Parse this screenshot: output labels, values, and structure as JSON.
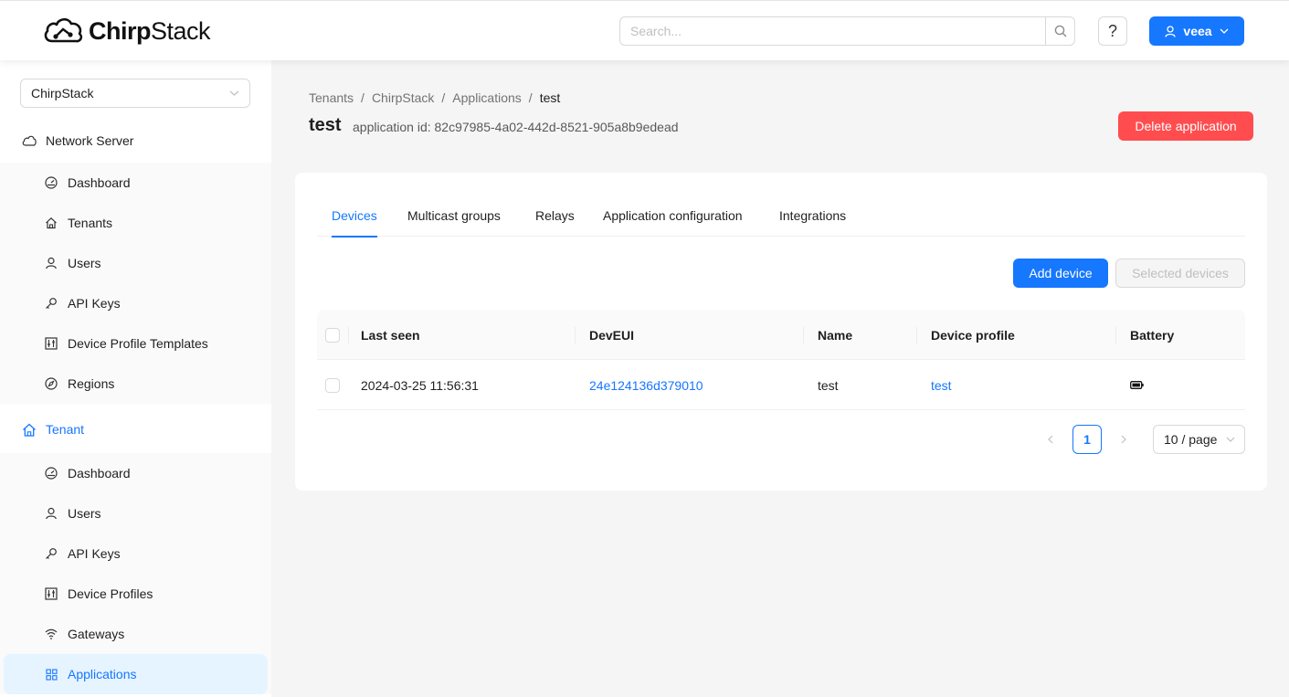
{
  "header": {
    "logo_text_bold": "Chirp",
    "logo_text_rest": "Stack",
    "search_placeholder": "Search...",
    "help_label": "?",
    "user_name": "veea"
  },
  "sidebar": {
    "tenant_select": "ChirpStack",
    "network_server": {
      "label": "Network Server",
      "items": [
        {
          "label": "Dashboard",
          "icon": "dashboard-icon"
        },
        {
          "label": "Tenants",
          "icon": "home-icon"
        },
        {
          "label": "Users",
          "icon": "user-icon"
        },
        {
          "label": "API Keys",
          "icon": "key-icon"
        },
        {
          "label": "Device Profile Templates",
          "icon": "control-icon"
        },
        {
          "label": "Regions",
          "icon": "compass-icon"
        }
      ]
    },
    "tenant": {
      "label": "Tenant",
      "items": [
        {
          "label": "Dashboard",
          "icon": "dashboard-icon"
        },
        {
          "label": "Users",
          "icon": "user-icon"
        },
        {
          "label": "API Keys",
          "icon": "key-icon"
        },
        {
          "label": "Device Profiles",
          "icon": "control-icon"
        },
        {
          "label": "Gateways",
          "icon": "wifi-icon"
        },
        {
          "label": "Applications",
          "icon": "appstore-icon"
        }
      ]
    }
  },
  "breadcrumb": [
    "Tenants",
    "ChirpStack",
    "Applications",
    "test"
  ],
  "page": {
    "title": "test",
    "subtitle": "application id: 82c97985-4a02-442d-8521-905a8b9edead",
    "delete_label": "Delete application"
  },
  "tabs": [
    "Devices",
    "Multicast groups",
    "Relays",
    "Application configuration",
    "Integrations"
  ],
  "actions": {
    "add_device": "Add device",
    "selected_devices": "Selected devices"
  },
  "table": {
    "headers": [
      "Last seen",
      "DevEUI",
      "Name",
      "Device profile",
      "Battery"
    ],
    "rows": [
      {
        "last_seen": "2024-03-25 11:56:31",
        "dev_eui": "24e124136d379010",
        "name": "test",
        "device_profile": "test",
        "battery_icon": "battery-icon"
      }
    ]
  },
  "pagination": {
    "current_page": "1",
    "page_size": "10 / page"
  },
  "colors": {
    "primary": "#1677ff",
    "danger": "#ff4d4f"
  }
}
